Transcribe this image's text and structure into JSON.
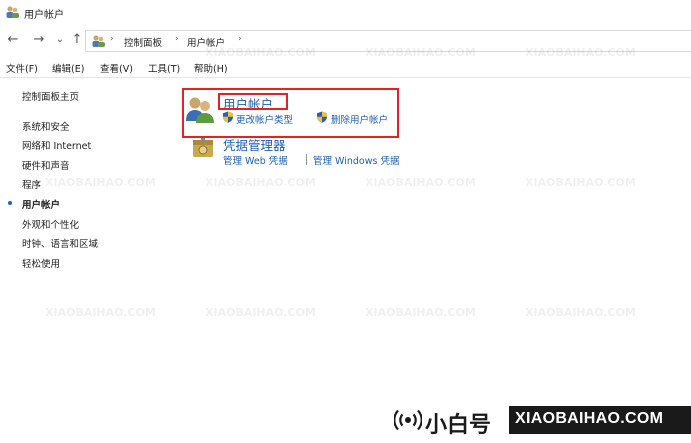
{
  "window": {
    "title": "用户帐户"
  },
  "nav": {
    "back": "←",
    "forward": "→",
    "recent": "⌄",
    "up": "↑",
    "breadcrumb": [
      "控制面板",
      "用户帐户"
    ],
    "separator": "›"
  },
  "menu": [
    "文件(F)",
    "编辑(E)",
    "查看(V)",
    "工具(T)",
    "帮助(H)"
  ],
  "sidebar": {
    "home": "控制面板主页",
    "items": [
      {
        "label": "系统和安全"
      },
      {
        "label": "网络和 Internet"
      },
      {
        "label": "硬件和声音"
      },
      {
        "label": "程序"
      },
      {
        "label": "用户帐户",
        "current": true
      },
      {
        "label": "外观和个性化"
      },
      {
        "label": "时钟、语言和区域"
      },
      {
        "label": "轻松使用"
      }
    ]
  },
  "categories": [
    {
      "title": "用户帐户",
      "icon": "user-accounts-icon",
      "links": [
        {
          "label": "更改帐户类型",
          "icon": "uac-shield-icon"
        },
        {
          "label": "删除用户帐户",
          "icon": "uac-shield-icon"
        }
      ]
    },
    {
      "title": "凭据管理器",
      "icon": "credential-manager-icon",
      "links": [
        {
          "label": "管理 Web 凭据"
        },
        {
          "label": "管理 Windows 凭据"
        }
      ]
    }
  ],
  "colors": {
    "link": "#1e5fb5",
    "highlight": "#e52222"
  },
  "watermark": {
    "brand_cn": "小白号",
    "brand_en": "XIAOBAIHAO.COM"
  }
}
